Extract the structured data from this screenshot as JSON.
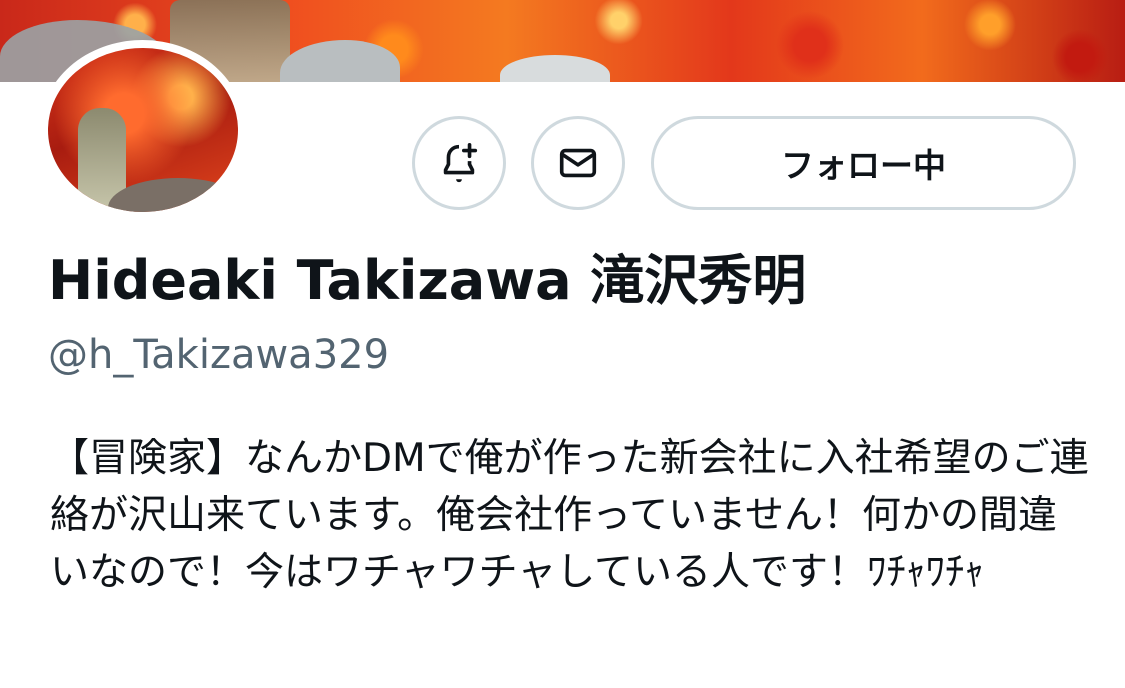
{
  "profile": {
    "display_name": "Hideaki Takizawa 滝沢秀明",
    "handle": "@h_Takizawa329",
    "bio": "【冒険家】なんかDMで俺が作った新会社に入社希望のご連絡が沢山来ています。俺会社作っていません！何かの間違いなので！今はワチャワチャしている人です！ﾜﾁｬﾜﾁｬ"
  },
  "actions": {
    "notify_icon": "bell-plus-icon",
    "message_icon": "envelope-icon",
    "follow_label": "フォロー中"
  },
  "colors": {
    "text_primary": "#0f1419",
    "text_secondary": "#536471",
    "button_border": "#cfd9de",
    "background": "#ffffff"
  }
}
